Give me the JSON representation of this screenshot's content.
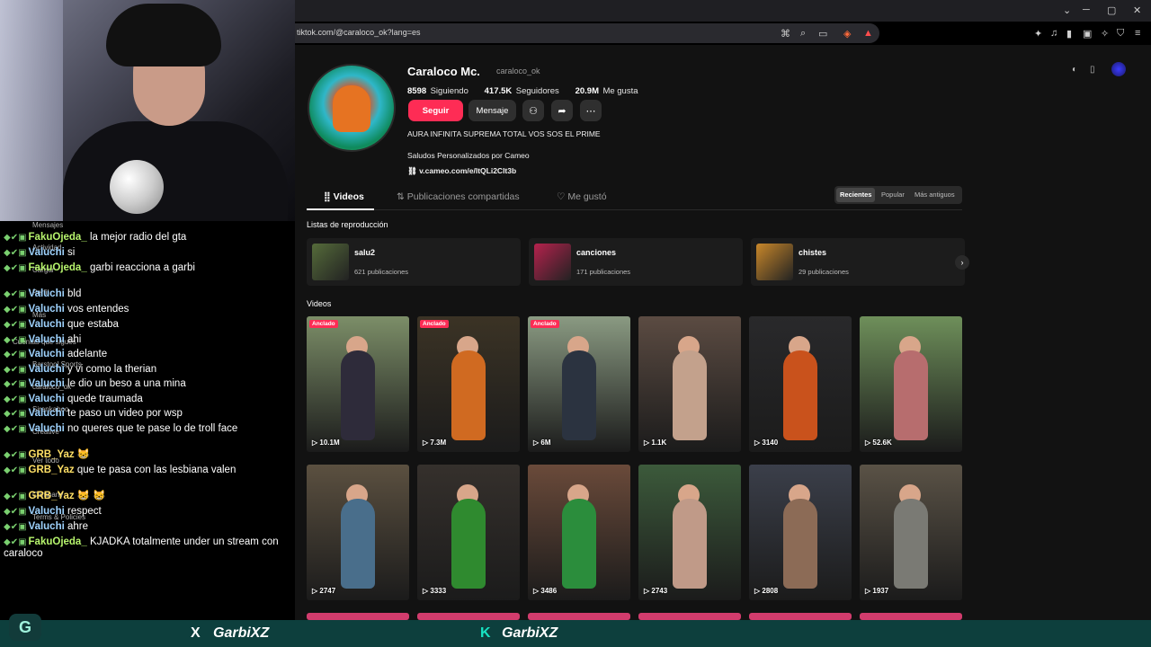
{
  "browser": {
    "url": "tiktok.com/@caraloco_ok?lang=es",
    "window_controls": [
      "⌄",
      "─",
      "▢",
      "✕"
    ]
  },
  "profile": {
    "name": "Caraloco Mc.",
    "handle": "caraloco_ok",
    "following_count": "8598",
    "following_label": "Siguiendo",
    "followers_count": "417.5K",
    "followers_label": "Seguidores",
    "likes_count": "20.9M",
    "likes_label": "Me gusta",
    "follow_label": "Seguir",
    "message_label": "Mensaje",
    "bio": "AURA INFINITA SUPREMA TOTAL VOS SOS EL PRIME",
    "bio2": "Saludos Personalizados por Cameo",
    "link": "v.cameo.com/e/ltQLi2Clt3b"
  },
  "tabs": {
    "videos": "Videos",
    "shared": "Publicaciones compartidas",
    "liked": "Me gustó"
  },
  "sort": {
    "recent": "Recientes",
    "popular": "Popular",
    "oldest": "Más antiguos"
  },
  "playlists": {
    "header": "Listas de reproducción",
    "items": [
      {
        "title": "salu2",
        "count": "621 publicaciones",
        "color": "#556b3a"
      },
      {
        "title": "canciones",
        "count": "171 publicaciones",
        "color": "#b5224d"
      },
      {
        "title": "chistes",
        "count": "29 publicaciones",
        "color": "#c8872a"
      }
    ]
  },
  "videos": {
    "header": "Videos",
    "pinned_label": "Anclado",
    "items": [
      {
        "views": "10.1M",
        "pinned": true,
        "bg": "#7c8e68",
        "fig": "#2e2b3a"
      },
      {
        "views": "7.3M",
        "pinned": true,
        "bg": "#3b3325",
        "fig": "#d06a21"
      },
      {
        "views": "6M",
        "pinned": true,
        "bg": "#8a9a82",
        "fig": "#2b3340"
      },
      {
        "views": "1.1K",
        "pinned": false,
        "bg": "#5b4b42",
        "fig": "#c3a18c"
      },
      {
        "views": "3140",
        "pinned": false,
        "bg": "#29292b",
        "fig": "#c9521c"
      },
      {
        "views": "52.6K",
        "pinned": false,
        "bg": "#6e8f5a",
        "fig": "#b76d6e"
      },
      {
        "views": "2747",
        "pinned": false,
        "bg": "#5b5040",
        "fig": "#496e8b"
      },
      {
        "views": "3333",
        "pinned": false,
        "bg": "#35302c",
        "fig": "#2f8a2f"
      },
      {
        "views": "3486",
        "pinned": false,
        "bg": "#6a4a3a",
        "fig": "#2b8d3c"
      },
      {
        "views": "2743",
        "pinned": false,
        "bg": "#3c5a3b",
        "fig": "#c09a88"
      },
      {
        "views": "2808",
        "pinned": false,
        "bg": "#3b3f4a",
        "fig": "#8c6b56"
      },
      {
        "views": "1937",
        "pinned": false,
        "bg": "#5a5246",
        "fig": "#7a7a74"
      }
    ]
  },
  "chat": [
    {
      "user": "FakuOjeda_",
      "msg": "la mejor radio del gta",
      "color": "green"
    },
    {
      "user": "Valuchi",
      "msg": "si",
      "color": "blue"
    },
    {
      "user": "FakuOjeda_",
      "msg": "garbi reacciona a garbi",
      "color": "green"
    },
    {
      "user": "Valuchi",
      "msg": "bld",
      "color": "blue"
    },
    {
      "user": "Valuchi",
      "msg": "vos entendes",
      "color": "blue"
    },
    {
      "user": "Valuchi",
      "msg": "que estaba",
      "color": "blue"
    },
    {
      "user": "Valuchi",
      "msg": "ahi",
      "color": "blue"
    },
    {
      "user": "Valuchi",
      "msg": "adelante",
      "color": "blue"
    },
    {
      "user": "Valuchi",
      "msg": "y vi como la therian",
      "color": "blue"
    },
    {
      "user": "Valuchi",
      "msg": "le dio un beso a una mina",
      "color": "blue"
    },
    {
      "user": "Valuchi",
      "msg": "quede traumada",
      "color": "blue"
    },
    {
      "user": "Valuchi",
      "msg": "te paso un video por wsp",
      "color": "blue"
    },
    {
      "user": "Valuchi",
      "msg": "no queres que te pase lo de troll face",
      "color": "blue"
    },
    {
      "user": "GRB_Yaz",
      "msg": "😸",
      "color": "yellow"
    },
    {
      "user": "GRB_Yaz",
      "msg": "que te pasa con las lesbiana valen",
      "color": "yellow"
    },
    {
      "user": "GRB_Yaz",
      "msg": "😸 😸",
      "color": "yellow"
    },
    {
      "user": "Valuchi",
      "msg": "respect",
      "color": "blue"
    },
    {
      "user": "Valuchi",
      "msg": "ahre",
      "color": "blue"
    },
    {
      "user": "FakuOjeda_",
      "msg": "KJADKA totalmente under un stream con caraloco",
      "color": "green"
    }
  ],
  "chat_ghost": [
    "Mensajes",
    "Actividad",
    "Cargar",
    "Perfil",
    "Más",
    "Cuentas que sigues",
    "Barstool Sports",
    "caraloco_ok",
    "Sirenkaboo",
    "Creative",
    "Ver todo",
    "Company",
    "Terms & Policies"
  ],
  "taskbar": {
    "x_handle": "GarbiXZ",
    "kick_handle": "GarbiXZ",
    "x_icon": "X",
    "kick_icon": "K",
    "logo_icon": "G"
  }
}
